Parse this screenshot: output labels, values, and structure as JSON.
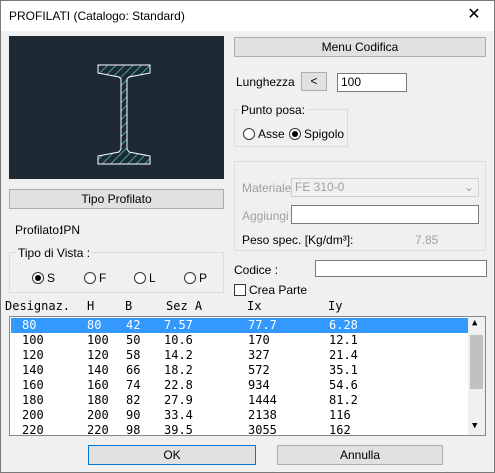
{
  "window": {
    "title": "PROFILATI (Catalogo: Standard)"
  },
  "buttons": {
    "menu_codifica": "Menu Codifica",
    "tipo_profilato": "Tipo Profilato",
    "decrement": "<",
    "ok": "OK",
    "annulla": "Annulla"
  },
  "lunghezza": {
    "label": "Lunghezza",
    "value": "100"
  },
  "punto_posa": {
    "label": "Punto posa:",
    "asse": "Asse",
    "spigolo": "Spigolo",
    "selected": "Spigolo"
  },
  "materiale": {
    "label": "Materiale",
    "value": "FE 310-0"
  },
  "aggiungi": {
    "label": "Aggiungi",
    "value": ""
  },
  "peso_spec": {
    "label": "Peso spec. [Kg/dm³]:",
    "value": "7.85"
  },
  "profilato": {
    "label": "Profilato:",
    "value": "IPN"
  },
  "tipo_vista": {
    "label": "Tipo di Vista :",
    "options": [
      "S",
      "F",
      "L",
      "P"
    ],
    "selected": "S"
  },
  "codice": {
    "label": "Codice :",
    "value": ""
  },
  "crea_parte": {
    "label": "Crea Parte",
    "checked": false
  },
  "table": {
    "headers": [
      "Designaz.",
      "H",
      "B",
      "Sez A",
      "Ix",
      "Iy"
    ],
    "rows": [
      [
        "80",
        "80",
        "42",
        "7.57",
        "77.7",
        "6.28"
      ],
      [
        "100",
        "100",
        "50",
        "10.6",
        "170",
        "12.1"
      ],
      [
        "120",
        "120",
        "58",
        "14.2",
        "327",
        "21.4"
      ],
      [
        "140",
        "140",
        "66",
        "18.2",
        "572",
        "35.1"
      ],
      [
        "160",
        "160",
        "74",
        "22.8",
        "934",
        "54.6"
      ],
      [
        "180",
        "180",
        "82",
        "27.9",
        "1444",
        "81.2"
      ],
      [
        "200",
        "200",
        "90",
        "33.4",
        "2138",
        "116"
      ],
      [
        "220",
        "220",
        "98",
        "39.5",
        "3055",
        "162"
      ]
    ],
    "selected_index": 0
  },
  "colors": {
    "selection": "#3399ff",
    "preview_bg": "#1e2a33",
    "hatch": "#4fd1c5"
  }
}
